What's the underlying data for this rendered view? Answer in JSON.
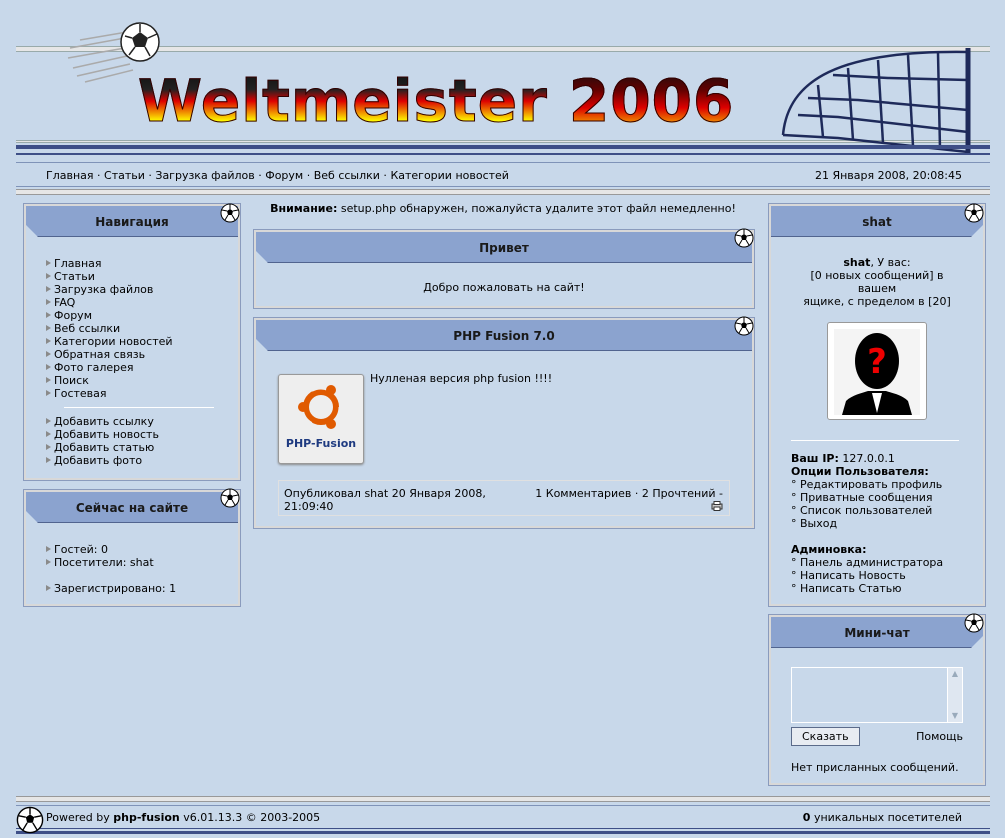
{
  "header": {
    "title": "Weltmeister",
    "title_year": "2006"
  },
  "menu": {
    "links": [
      "Главная",
      "Статьи",
      "Загрузка файлов",
      "Форум",
      "Веб ссылки",
      "Категории новостей"
    ],
    "separator": " · ",
    "date": "21 Января 2008, 20:08:45"
  },
  "nav_panel": {
    "title": "Навигация",
    "items": [
      "Главная",
      "Статьи",
      "Загрузка файлов",
      "FAQ",
      "Форум",
      "Веб ссылки",
      "Категории новостей",
      "Обратная связь",
      "Фото галерея",
      "Поиск",
      "Гостевая"
    ],
    "submit_items": [
      "Добавить ссылку",
      "Добавить новость",
      "Добавить статью",
      "Добавить фото"
    ]
  },
  "online_panel": {
    "title": "Сейчас на сайте",
    "guests": "Гостей: 0",
    "members": "Посетители: shat",
    "registered": "Зарегистрировано: 1"
  },
  "warning": {
    "label": "Внимание:",
    "text": "setup.php обнаружен, пожалуйста удалите этот файл немедленно!"
  },
  "welcome_panel": {
    "title": "Привет",
    "text": "Добро пожаловать на сайт!"
  },
  "news": {
    "title": "PHP Fusion 7.0",
    "image_label": "PHP-Fusion",
    "body": "Нулленая версия php fusion !!!!",
    "posted": "Опубликовал shat 20 Января 2008, 21:09:40",
    "stats": "1 Комментариев · 2 Прочтений -"
  },
  "user_panel": {
    "title": "shat",
    "greeting_name": "shat",
    "greeting_rest": ", У вас:",
    "msg_line": "[0 новых сообщений] в вашем",
    "box_line": "ящике, с пределом в [20]",
    "ip_label": "Ваш IP:",
    "ip_value": "127.0.0.1",
    "options_label": "Опции Пользователя:",
    "options": [
      "Редактировать профиль",
      "Приватные сообщения",
      "Список пользователей",
      "Выход"
    ],
    "admin_label": "Админовка:",
    "admin": [
      "Панель администратора",
      "Написать Новость",
      "Написать Статью"
    ]
  },
  "minichat": {
    "title": "Мини-чат",
    "send_button": "Сказать",
    "help_link": "Помощь",
    "empty_text": "Нет присланных сообщений."
  },
  "footer": {
    "powered_prefix": "Powered by ",
    "powered_name": "php-fusion",
    "powered_suffix": " v6.01.13.3 © 2003-2005",
    "visitors_count": "0",
    "visitors_label": " уникальных посетителей"
  }
}
